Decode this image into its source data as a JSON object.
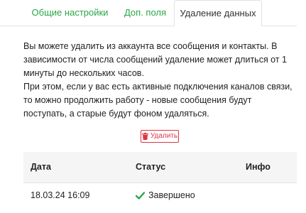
{
  "tabs": [
    {
      "label": "Общие настройки",
      "active": false
    },
    {
      "label": "Доп. поля",
      "active": false
    },
    {
      "label": "Удаление данных",
      "active": true
    }
  ],
  "description": {
    "paragraph1": "Вы можете удалить из аккаунта все сообщения и контакты. В зависимости от числа сообщений удаление может длиться от 1 минуты до нескольких часов.",
    "paragraph2": "При этом, если у вас есть активные подключения каналов связи, то можно продолжить работу - новые сообщения будут поступать, а старые будут фоном удаляться."
  },
  "delete_button": {
    "label": "Удалить",
    "icon": "trash-icon",
    "color": "#dc3545"
  },
  "table": {
    "headers": [
      "Дата",
      "Статус",
      "Инфо"
    ],
    "rows": [
      {
        "date": "18.03.24 16:09",
        "status": "Завершено",
        "status_icon": "check-icon",
        "info": ""
      }
    ]
  },
  "colors": {
    "accent": "#28a745",
    "danger": "#dc3545"
  }
}
